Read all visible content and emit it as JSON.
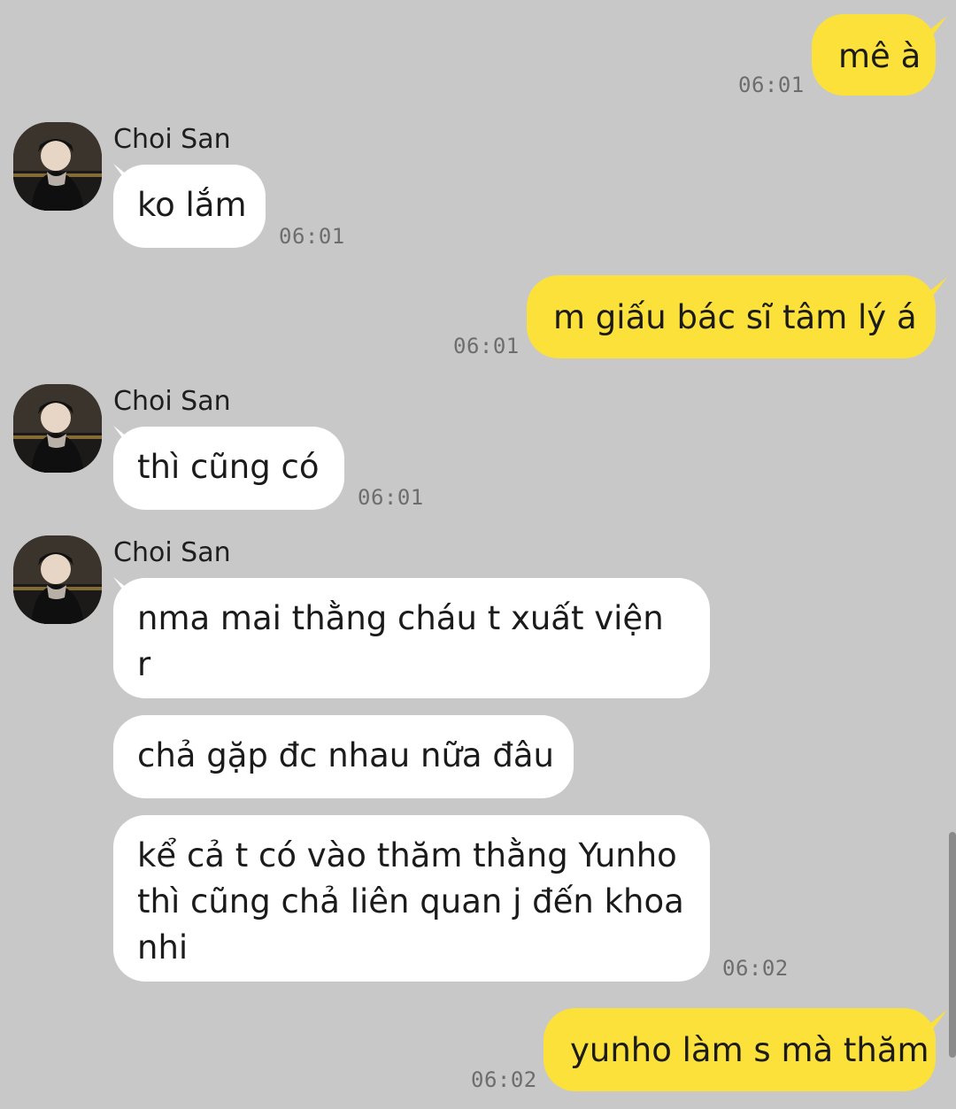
{
  "colors": {
    "background": "#c8c8c8",
    "my_bubble": "#fbe13a",
    "their_bubble": "#ffffff",
    "timestamp": "#6d6d6d"
  },
  "contact": {
    "name": "Choi San",
    "avatar_icon": "profile-photo-icon"
  },
  "messages": [
    {
      "from": "me",
      "text": "mê à",
      "time": "06:01"
    },
    {
      "from": "them",
      "text": "ko lắm",
      "time": "06:01"
    },
    {
      "from": "me",
      "text": "m giấu bác sĩ tâm lý á",
      "time": "06:01"
    },
    {
      "from": "them",
      "text": "thì cũng có",
      "time": "06:01"
    },
    {
      "from": "them",
      "text": "nma mai thằng cháu t xuất viện r"
    },
    {
      "from": "them",
      "text": "chả gặp đc nhau nữa đâu"
    },
    {
      "from": "them",
      "text": "kể cả t có vào thăm thằng Yunho thì cũng chả liên quan j đến khoa nhi",
      "time": "06:02"
    },
    {
      "from": "me",
      "text": "yunho làm s mà thăm",
      "time": "06:02"
    }
  ]
}
